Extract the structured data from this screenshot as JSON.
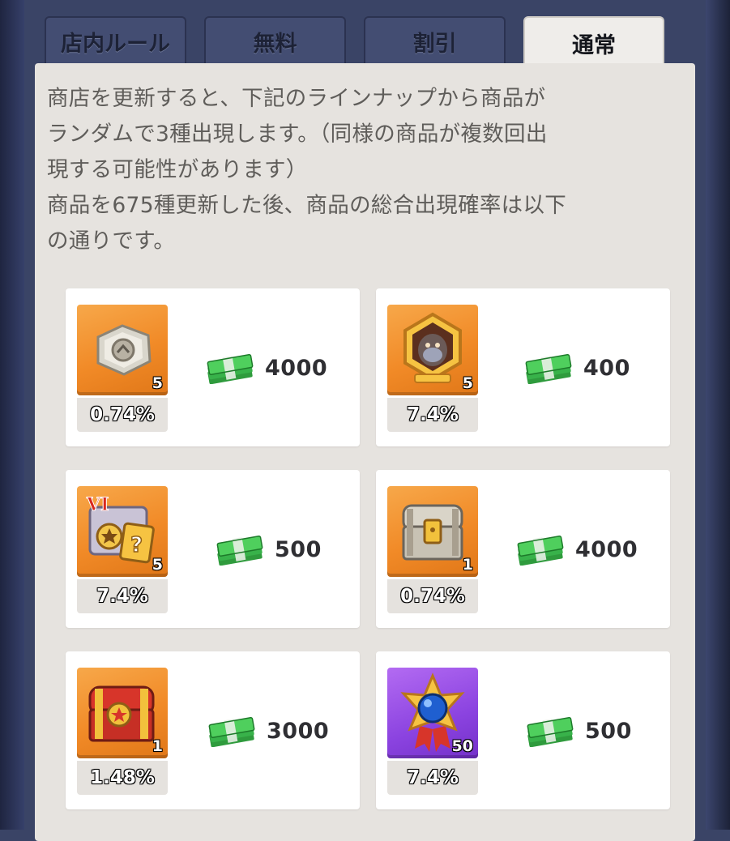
{
  "tabs": [
    {
      "label": "店内ルール",
      "active": false
    },
    {
      "label": "無料",
      "active": false
    },
    {
      "label": "割引",
      "active": false
    },
    {
      "label": "通常",
      "active": true
    }
  ],
  "description": [
    "商店を更新すると、下記のラインナップから商品が",
    "ランダムで3種出現します。（同様の商品が複数回出",
    "現する可能性があります）",
    "商品を675種更新した後、商品の総合出現確率は以下",
    "の通りです。"
  ],
  "items": [
    {
      "icon": "gear-chip-icon",
      "quantity": "5",
      "rate": "0.74%",
      "price": "4000",
      "theme": "orange"
    },
    {
      "icon": "gorilla-hero-medal-icon",
      "quantity": "5",
      "rate": "7.4%",
      "price": "400",
      "theme": "orange"
    },
    {
      "icon": "vi-mystery-card-pack-icon",
      "quantity": "5",
      "rate": "7.4%",
      "price": "500",
      "theme": "orange"
    },
    {
      "icon": "silver-treasure-chest-icon",
      "quantity": "1",
      "rate": "0.74%",
      "price": "4000",
      "theme": "orange"
    },
    {
      "icon": "red-gold-chest-icon",
      "quantity": "1",
      "rate": "1.48%",
      "price": "3000",
      "theme": "orange"
    },
    {
      "icon": "blue-star-badge-icon",
      "quantity": "50",
      "rate": "7.4%",
      "price": "500",
      "theme": "purple"
    }
  ],
  "currency_icon": "cash-stack-icon",
  "colors": {
    "orange": "#f18a27",
    "purple": "#8b43e0",
    "cash": "#38b24a"
  }
}
